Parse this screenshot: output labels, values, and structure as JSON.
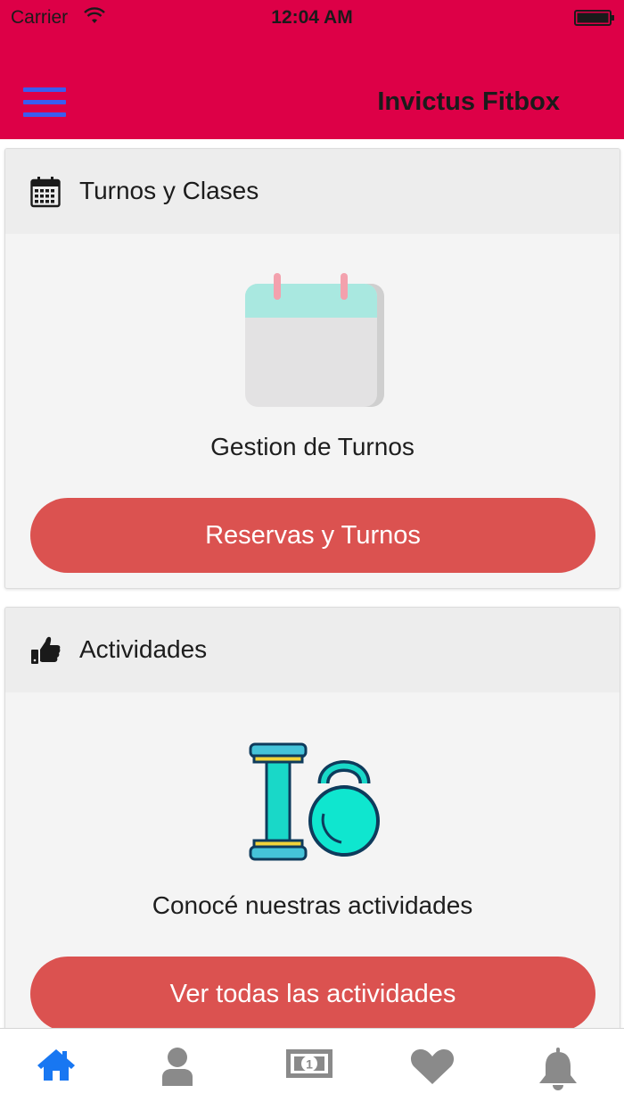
{
  "status_bar": {
    "carrier": "Carrier",
    "time": "12:04 AM"
  },
  "header": {
    "title": "Invictus Fitbox",
    "menu_icon": "hamburger-menu-icon",
    "background_color": "#dd0047",
    "menu_icon_color": "#3a5cf0"
  },
  "cards": [
    {
      "header_icon": "calendar-icon",
      "title": "Turnos y Clases",
      "illustration": "calendar-illustration",
      "caption": "Gestion de Turnos",
      "button_label": "Reservas y Turnos"
    },
    {
      "header_icon": "thumbs-up-icon",
      "title": "Actividades",
      "illustration": "dumbbell-kettlebell-illustration",
      "caption": "Conocé nuestras actividades",
      "button_label": "Ver todas las actividades"
    }
  ],
  "button_color": "#db5250",
  "tab_bar": {
    "active_color": "#1877f2",
    "inactive_color": "#8a8a8a",
    "items": [
      {
        "icon": "home-icon",
        "active": true
      },
      {
        "icon": "user-icon",
        "active": false
      },
      {
        "icon": "money-icon",
        "active": false
      },
      {
        "icon": "heart-icon",
        "active": false
      },
      {
        "icon": "bell-icon",
        "active": false
      }
    ]
  }
}
